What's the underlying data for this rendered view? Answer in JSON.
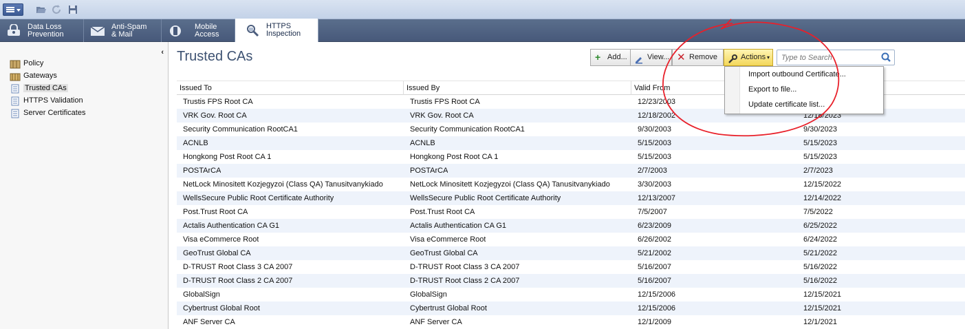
{
  "colors": {
    "annotation_red": "#e8202a",
    "accent_blue": "#3d5272",
    "actions_yellow": "#f3d75a"
  },
  "toolbar": {
    "menu_icon": "hamburger-menu-icon",
    "open_icon": "folder-open-icon",
    "refresh_icon": "refresh-icon",
    "save_icon": "save-icon"
  },
  "blades": [
    {
      "label": "Data Loss\nPrevention",
      "icon": "dlp-icon"
    },
    {
      "label": "Anti-Spam\n& Mail",
      "icon": "mail-icon"
    },
    {
      "label": "Mobile\nAccess",
      "icon": "mobile-access-icon"
    },
    {
      "label": "HTTPS\nInspection",
      "icon": "https-inspection-icon"
    }
  ],
  "sidebar": {
    "items": [
      {
        "label": "Policy",
        "icon": "policy-icon"
      },
      {
        "label": "Gateways",
        "icon": "gateways-icon"
      },
      {
        "label": "Trusted CAs",
        "icon": "document-icon"
      },
      {
        "label": "HTTPS Validation",
        "icon": "document-icon"
      },
      {
        "label": "Server Certificates",
        "icon": "document-icon"
      }
    ]
  },
  "main": {
    "title": "Trusted CAs",
    "buttons": {
      "add": "Add...",
      "view": "View...",
      "remove": "Remove",
      "actions": "Actions"
    },
    "search_placeholder": "Type to Search",
    "actions_menu": [
      "Import outbound Certificate...",
      "Export to file...",
      "Update certificate list..."
    ],
    "columns": [
      "Issued To",
      "Issued By",
      "Valid From",
      ""
    ],
    "rows": [
      [
        "Trustis FPS Root CA",
        "Trustis FPS Root CA",
        "12/23/2003",
        ""
      ],
      [
        "VRK Gov. Root CA",
        "VRK Gov. Root CA",
        "12/18/2002",
        "12/18/2023"
      ],
      [
        "Security Communication RootCA1",
        "Security Communication RootCA1",
        "9/30/2003",
        "9/30/2023"
      ],
      [
        "ACNLB",
        "ACNLB",
        "5/15/2003",
        "5/15/2023"
      ],
      [
        "Hongkong Post Root CA 1",
        "Hongkong Post Root CA 1",
        "5/15/2003",
        "5/15/2023"
      ],
      [
        "POSTArCA",
        "POSTArCA",
        "2/7/2003",
        "2/7/2023"
      ],
      [
        "NetLock Minositett Kozjegyzoi (Class QA) Tanusitvanykiado",
        "NetLock Minositett Kozjegyzoi (Class QA) Tanusitvanykiado",
        "3/30/2003",
        "12/15/2022"
      ],
      [
        "WellsSecure Public Root Certificate Authority",
        "WellsSecure Public Root Certificate Authority",
        "12/13/2007",
        "12/14/2022"
      ],
      [
        "Post.Trust Root CA",
        "Post.Trust Root CA",
        "7/5/2007",
        "7/5/2022"
      ],
      [
        "Actalis Authentication CA G1",
        "Actalis Authentication CA G1",
        "6/23/2009",
        "6/25/2022"
      ],
      [
        "Visa eCommerce Root",
        "Visa eCommerce Root",
        "6/26/2002",
        "6/24/2022"
      ],
      [
        "GeoTrust Global CA",
        "GeoTrust Global CA",
        "5/21/2002",
        "5/21/2022"
      ],
      [
        "D-TRUST Root Class 3 CA 2007",
        "D-TRUST Root Class 3 CA 2007",
        "5/16/2007",
        "5/16/2022"
      ],
      [
        "D-TRUST Root Class 2 CA 2007",
        "D-TRUST Root Class 2 CA 2007",
        "5/16/2007",
        "5/16/2022"
      ],
      [
        "GlobalSign",
        "GlobalSign",
        "12/15/2006",
        "12/15/2021"
      ],
      [
        "Cybertrust Global Root",
        "Cybertrust Global Root",
        "12/15/2006",
        "12/15/2021"
      ],
      [
        "ANF Server CA",
        "ANF Server CA",
        "12/1/2009",
        "12/1/2021"
      ]
    ]
  }
}
